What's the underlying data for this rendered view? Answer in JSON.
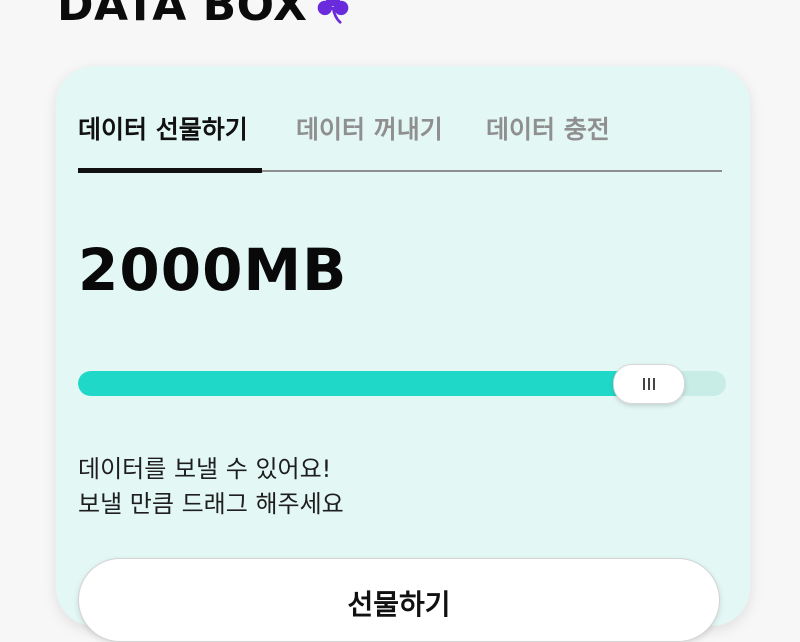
{
  "brand": {
    "title": "DATA BOX",
    "logo_icon": "clover-icon",
    "logo_color": "#6a2bdc"
  },
  "tabs": [
    {
      "label": "데이터 선물하기",
      "active": true
    },
    {
      "label": "데이터 꺼내기",
      "active": false
    },
    {
      "label": "데이터 충전",
      "active": false
    }
  ],
  "amount": "2000MB",
  "slider": {
    "fill_percent": 88,
    "fill_color": "#20d8c8"
  },
  "helper": {
    "line1": "데이터를 보낼 수 있어요!",
    "line2": "보낼 만큼 드래그 해주세요"
  },
  "submit": {
    "label": "선물하기"
  },
  "colors": {
    "card_background": "#e3f7f4",
    "accent": "#20d8c8"
  }
}
